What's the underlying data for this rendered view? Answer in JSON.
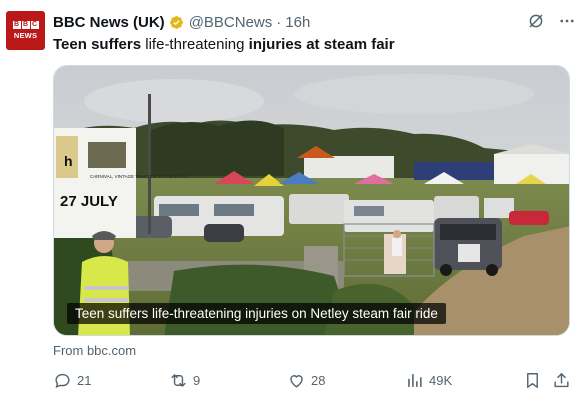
{
  "tweet": {
    "author_name": "BBC News (UK)",
    "handle": "@BBCNews",
    "separator": "·",
    "timestamp": "16h",
    "avatar": {
      "line1": [
        "B",
        "B",
        "C"
      ],
      "line2": "NEWS"
    },
    "text_parts": [
      {
        "text": "Teen suffers ",
        "bold": true
      },
      {
        "text": "life",
        "bold": false
      },
      {
        "text": "-threatening ",
        "bold": false
      },
      {
        "text": "injuries at steam fair",
        "bold": true
      }
    ],
    "media": {
      "caption": "Teen suffers life-threatening injuries on Netley steam fair ride",
      "sign_text": {
        "date": "27 JULY",
        "partial": "h",
        "event": "CARNIVAL, VINTAGE TRACTOR STEAM RALLY"
      }
    },
    "source": "From bbc.com"
  },
  "actions": {
    "replies": "21",
    "retweets": "9",
    "likes": "28",
    "views": "49K"
  },
  "colors": {
    "bbc_red": "#bb1919",
    "verified_gold": "#e2b719",
    "muted": "#536471"
  }
}
